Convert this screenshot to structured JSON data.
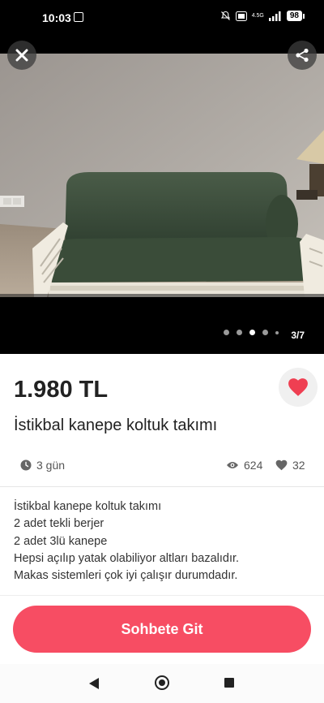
{
  "status_bar": {
    "time": "10:03",
    "network_label": "4.5G",
    "battery": "98"
  },
  "gallery": {
    "counter": "3/7",
    "dots": [
      "inactive",
      "inactive",
      "active",
      "inactive",
      "small"
    ]
  },
  "listing": {
    "price": "1.980 TL",
    "title": "İstikbal kanepe koltuk takımı",
    "posted": "3 gün",
    "views": "624",
    "likes": "32",
    "description": [
      "İstikbal kanepe koltuk takımı",
      "2 adet tekli berjer",
      "2 adet 3lü kanepe",
      "Hepsi açılıp yatak olabiliyor altları bazalıdır.",
      "Makas sistemleri çok iyi çalışır durumdadır."
    ]
  },
  "actions": {
    "chat_button": "Sohbete Git"
  },
  "colors": {
    "accent": "#f74d63",
    "favorite": "#ef3f52"
  },
  "icons": [
    "close-icon",
    "share-icon",
    "heart-icon",
    "clock-icon",
    "eye-icon",
    "heart-outline-icon",
    "back-icon",
    "home-icon",
    "recents-icon"
  ]
}
